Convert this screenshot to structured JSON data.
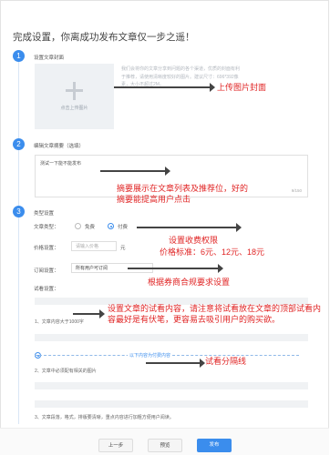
{
  "page": {
    "title": "完成设置，你离成功发布文章仅一步之遥！"
  },
  "steps": [
    {
      "number": "1",
      "label": "设置文章封面"
    },
    {
      "number": "2",
      "label": "编辑文章摘要（选填）"
    },
    {
      "number": "3",
      "label": "类型设置"
    }
  ],
  "cover": {
    "upload_label": "点击上传图片",
    "hint": "我们会将你的文章分享到问题的各个渠道，优质的封面有利于推荐，请使用清晰度较好的图片。建议尺寸：696*392像素，大小不超过2M。",
    "size_hint": "2M。"
  },
  "summary": {
    "value": "测试一下能不能发布",
    "counter": "9/150"
  },
  "type": {
    "type_label": "文章类型：",
    "option_free": "免费",
    "option_paid": "付费",
    "price_label": "价格设置：",
    "price_placeholder": "请输入价格",
    "price_unit": "元",
    "subscription_label": "订阅设置：",
    "subscription_value": "所有用户可订阅",
    "preview_label": "试看设置："
  },
  "preview_rules": [
    "1、文章内容大于1000字",
    "2、文章中必须配有相关的图片",
    "3、文章段落，格式，排版要清晰，重点内容进行加粗方便用户阅读。"
  ],
  "divider": {
    "label": "以下内容为付费内容"
  },
  "buttons": {
    "prev": "上一步",
    "preview": "预览",
    "publish": "发布"
  },
  "annotations": {
    "upload_cover": "上传图片封面",
    "summary_note": "摘要展示在文章列表及推荐位，好的摘要能提高用户点击",
    "pricing_title": "设置收费权限",
    "pricing_standard": "价格标准：6元、12元、18元",
    "subscription_note": "根据券商合规要求设置",
    "preview_note": "设置文章的试看内容，请注意将试看放在文章的顶部试看内容最好是有伏笔，更容易去吸引用户的购买欲。",
    "divider_note": "试看分隔线"
  },
  "colors": {
    "accent": "#3b8ded",
    "annotation": "#e02424"
  }
}
